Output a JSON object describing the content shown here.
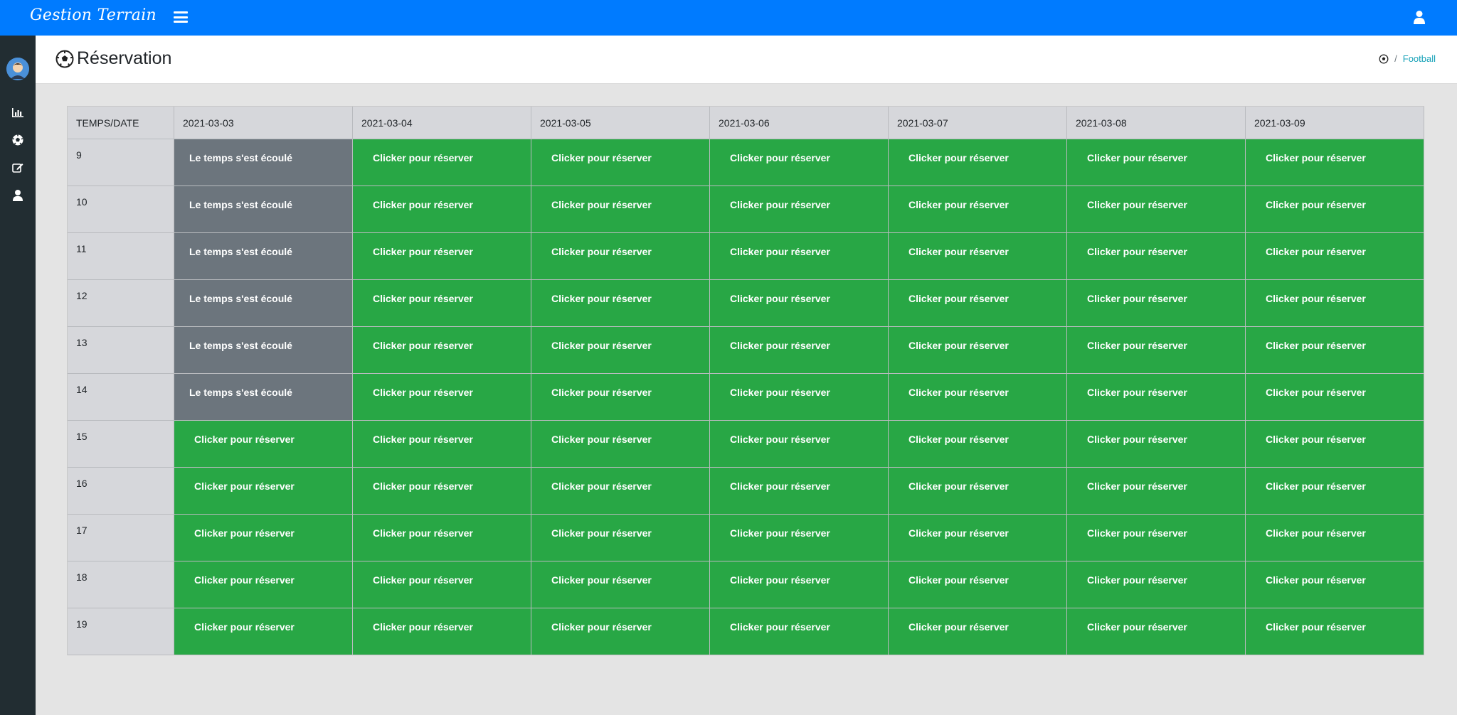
{
  "app": {
    "brand": "Gestion Terrain"
  },
  "colors": {
    "topbar": "#007bff",
    "sidebar": "#222d32",
    "free": "#28a745",
    "past": "#6c757d",
    "breadcrumb_link": "#17a2b8"
  },
  "icons": {
    "menu": "hamburger-icon",
    "user": "user-icon",
    "sidebar": [
      "bar-chart-icon",
      "soccer-ball-icon",
      "edit-icon",
      "user-icon"
    ],
    "title": "soccer-ball-icon"
  },
  "header": {
    "title": "Réservation",
    "breadcrumb": {
      "separator": "/",
      "link": "Football"
    }
  },
  "table": {
    "corner": "TEMPS/DATE",
    "dates": [
      "2021-03-03",
      "2021-03-04",
      "2021-03-05",
      "2021-03-06",
      "2021-03-07",
      "2021-03-08",
      "2021-03-09"
    ],
    "free_label": "Clicker pour réserver",
    "past_label": "Le temps s'est écoulé",
    "rows": [
      {
        "time": "9",
        "slots": [
          "past",
          "free",
          "free",
          "free",
          "free",
          "free",
          "free"
        ]
      },
      {
        "time": "10",
        "slots": [
          "past",
          "free",
          "free",
          "free",
          "free",
          "free",
          "free"
        ]
      },
      {
        "time": "11",
        "slots": [
          "past",
          "free",
          "free",
          "free",
          "free",
          "free",
          "free"
        ]
      },
      {
        "time": "12",
        "slots": [
          "past",
          "free",
          "free",
          "free",
          "free",
          "free",
          "free"
        ]
      },
      {
        "time": "13",
        "slots": [
          "past",
          "free",
          "free",
          "free",
          "free",
          "free",
          "free"
        ]
      },
      {
        "time": "14",
        "slots": [
          "past",
          "free",
          "free",
          "free",
          "free",
          "free",
          "free"
        ]
      },
      {
        "time": "15",
        "slots": [
          "free",
          "free",
          "free",
          "free",
          "free",
          "free",
          "free"
        ]
      },
      {
        "time": "16",
        "slots": [
          "free",
          "free",
          "free",
          "free",
          "free",
          "free",
          "free"
        ]
      },
      {
        "time": "17",
        "slots": [
          "free",
          "free",
          "free",
          "free",
          "free",
          "free",
          "free"
        ]
      },
      {
        "time": "18",
        "slots": [
          "free",
          "free",
          "free",
          "free",
          "free",
          "free",
          "free"
        ]
      },
      {
        "time": "19",
        "slots": [
          "free",
          "free",
          "free",
          "free",
          "free",
          "free",
          "free"
        ]
      }
    ]
  }
}
